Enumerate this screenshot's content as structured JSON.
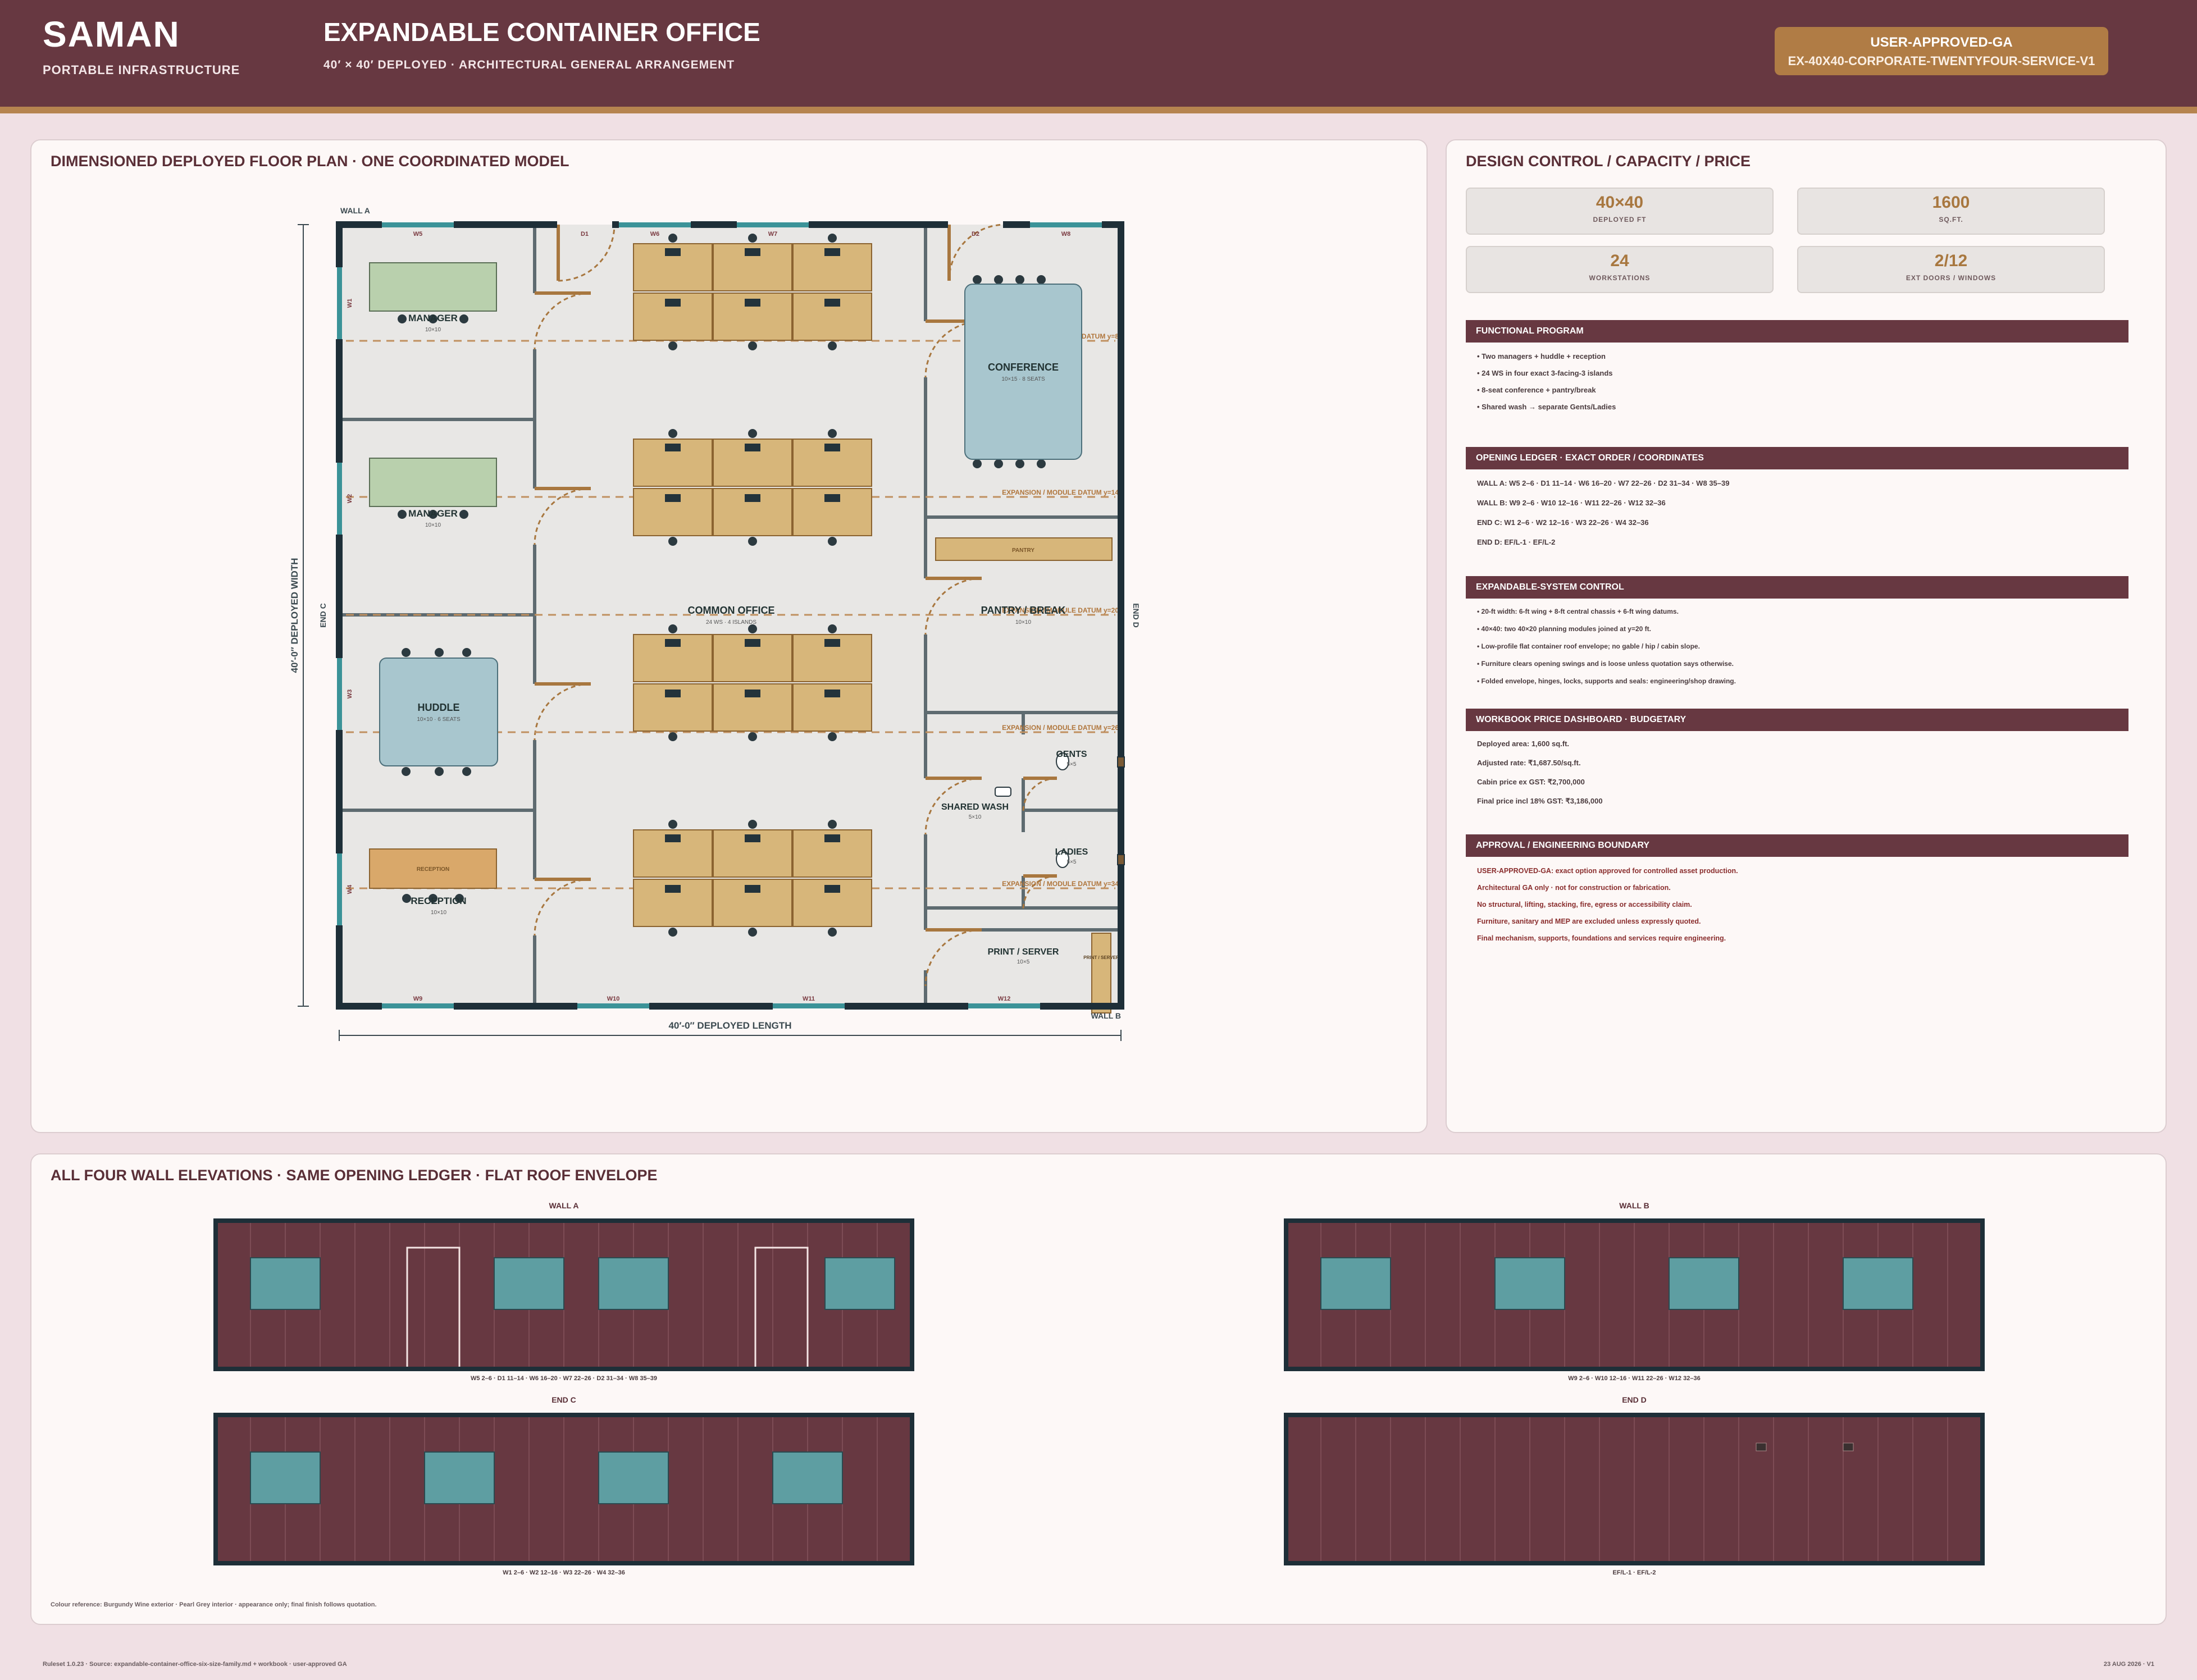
{
  "header": {
    "brand": "SAMAN",
    "brand_sub": "PORTABLE INFRASTRUCTURE",
    "title": "EXPANDABLE CONTAINER OFFICE",
    "subtitle": "40′ × 40′ DEPLOYED · ARCHITECTURAL GENERAL ARRANGEMENT",
    "badge_status": "USER-APPROVED-GA",
    "badge_code": "EX-40X40-CORPORATE-TWENTYFOUR-SERVICE-V1"
  },
  "plan": {
    "title": "DIMENSIONED DEPLOYED FLOOR PLAN · ONE COORDINATED MODEL",
    "wall_a": "WALL A",
    "wall_b": "WALL B",
    "end_c": "END C",
    "end_d": "END D",
    "width_dim": "40′-0″ DEPLOYED WIDTH",
    "length_dim": "40′-0″ DEPLOYED LENGTH",
    "top_openings": [
      "W5",
      "D1",
      "W6",
      "W7",
      "D2",
      "W8"
    ],
    "bottom_openings": [
      "W9",
      "W10",
      "W11",
      "W12"
    ],
    "left_openings": [
      "W1",
      "W2",
      "W3",
      "W4"
    ],
    "rooms": {
      "manager1": "MANAGER",
      "manager1_size": "10×10",
      "manager2": "MANAGER",
      "manager2_size": "10×10",
      "huddle": "HUDDLE",
      "huddle_size": "10×10 · 6 SEATS",
      "reception": "RECEPTION",
      "reception_size": "10×10",
      "reception_desk": "RECEPTION",
      "common": "COMMON OFFICE",
      "common_size": "24 WS · 4 ISLANDS",
      "conference": "CONFERENCE",
      "conference_size": "10×15 · 8 SEATS",
      "pantry": "PANTRY / BREAK",
      "pantry_size": "10×10",
      "pantry_counter": "PANTRY",
      "shared_wash": "SHARED WASH",
      "shared_wash_size": "5×10",
      "gents": "GENTS",
      "gents_size": "5×5",
      "ladies": "LADIES",
      "ladies_size": "5×5",
      "print": "PRINT / SERVER",
      "print_size": "10×5",
      "print_desk": "PRINT / SERVER"
    },
    "datums": [
      "DATUM y=8",
      "EXPANSION / MODULE DATUM y=14",
      "EXPANSION / MODULE DATUM y=20",
      "EXPANSION / MODULE DATUM y=26",
      "EXPANSION / MODULE DATUM y=34"
    ]
  },
  "control": {
    "title": "DESIGN CONTROL / CAPACITY / PRICE",
    "stats": [
      {
        "value": "40×40",
        "label": "DEPLOYED FT"
      },
      {
        "value": "1600",
        "label": "SQ.FT."
      },
      {
        "value": "24",
        "label": "WORKSTATIONS"
      },
      {
        "value": "2/12",
        "label": "EXT DOORS / WINDOWS"
      }
    ],
    "sections": [
      {
        "title": "FUNCTIONAL PROGRAM",
        "lines": [
          "• Two managers + huddle + reception",
          "• 24 WS in four exact 3-facing-3 islands",
          "• 8-seat conference + pantry/break",
          "• Shared wash → separate Gents/Ladies"
        ]
      },
      {
        "title": "OPENING LEDGER · EXACT ORDER / COORDINATES",
        "lines": [
          "WALL A: W5 2–6 · D1 11–14 · W6 16–20 · W7 22–26 · D2 31–34 · W8 35–39",
          "WALL B: W9 2–6 · W10 12–16 · W11 22–26 · W12 32–36",
          "END C: W1 2–6 · W2 12–16 · W3 22–26 · W4 32–36",
          "END D: EF/L-1 · EF/L-2"
        ]
      },
      {
        "title": "EXPANDABLE-SYSTEM CONTROL",
        "lines": [
          "• 20-ft width: 6-ft wing + 8-ft central chassis + 6-ft wing datums.",
          "• 40×40: two 40×20 planning modules joined at y=20 ft.",
          "• Low-profile flat container roof envelope; no gable / hip / cabin slope.",
          "• Furniture clears opening swings and is loose unless quotation says otherwise.",
          "• Folded envelope, hinges, locks, supports and seals: engineering/shop drawing."
        ]
      },
      {
        "title": "WORKBOOK PRICE DASHBOARD · BUDGETARY",
        "lines": [
          "Deployed area: 1,600 sq.ft.",
          "Adjusted rate: ₹1,687.50/sq.ft.",
          "Cabin price ex GST: ₹2,700,000",
          "Final price incl 18% GST: ₹3,186,000"
        ]
      },
      {
        "title": "APPROVAL / ENGINEERING BOUNDARY",
        "lines": [
          "USER-APPROVED-GA: exact option approved for controlled asset production.",
          "Architectural GA only · not for construction or fabrication.",
          "No structural, lifting, stacking, fire, egress or accessibility claim.",
          "Furniture, sanitary and MEP are excluded unless expressly quoted.",
          "Final mechanism, supports, foundations and services require engineering."
        ]
      }
    ]
  },
  "elevations": {
    "title": "ALL FOUR WALL ELEVATIONS · SAME OPENING LEDGER · FLAT ROOF ENVELOPE",
    "wall_a": {
      "label": "WALL A",
      "caption": "W5 2–6 · D1 11–14 · W6 16–20 · W7 22–26 · D2 31–34 · W8 35–39"
    },
    "wall_b": {
      "label": "WALL B",
      "caption": "W9 2–6 · W10 12–16 · W11 22–26 · W12 32–36"
    },
    "end_c": {
      "label": "END C",
      "caption": "W1 2–6 · W2 12–16 · W3 22–26 · W4 32–36"
    },
    "end_d": {
      "label": "END D",
      "caption": "EF/L-1 · EF/L-2"
    },
    "colour_ref": "Colour reference: Burgundy Wine exterior · Pearl Grey interior · appearance only; final finish follows quotation."
  },
  "footer": {
    "left": "Ruleset 1.0.23 · Source: expandable-container-office-six-size-family.md + workbook · user-approved GA",
    "right": "23 AUG 2026 · V1"
  },
  "colors": {
    "burgundy": "#673841",
    "gold": "#b07c45",
    "wall": "#1e2f38",
    "glass": "#3b9398",
    "desk": "#d7b67a"
  }
}
